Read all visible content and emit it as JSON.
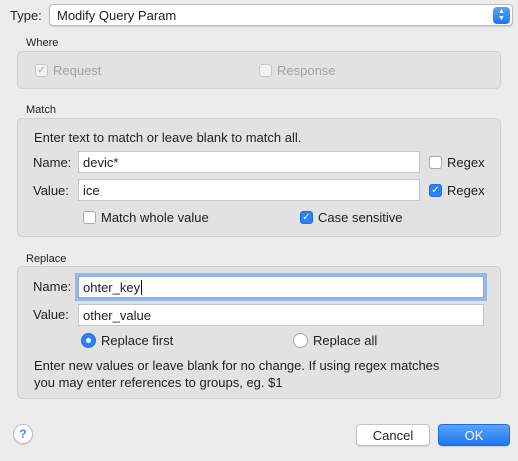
{
  "type": {
    "label": "Type:",
    "value": "Modify Query Param"
  },
  "where": {
    "title": "Where",
    "request": {
      "label": "Request",
      "checked": true,
      "enabled": false
    },
    "response": {
      "label": "Response",
      "checked": false,
      "enabled": false
    }
  },
  "match": {
    "title": "Match",
    "hint": "Enter text to match or leave blank to match all.",
    "name_label": "Name:",
    "name_value": "devic*",
    "name_regex_label": "Regex",
    "name_regex_checked": false,
    "value_label": "Value:",
    "value_value": "ice",
    "value_regex_label": "Regex",
    "value_regex_checked": true,
    "whole_value_label": "Match whole value",
    "whole_value_checked": false,
    "case_sensitive_label": "Case sensitive",
    "case_sensitive_checked": true
  },
  "replace": {
    "title": "Replace",
    "name_label": "Name:",
    "name_value": "ohter_key",
    "value_label": "Value:",
    "value_value": "other_value",
    "replace_first_label": "Replace first",
    "replace_all_label": "Replace all",
    "selected": "first",
    "hint_line1": "Enter new values or leave blank for no change. If using regex matches",
    "hint_line2": "you may enter references to groups, eg. $1"
  },
  "footer": {
    "help": "?",
    "cancel_label": "Cancel",
    "ok_label": "OK"
  },
  "colors": {
    "accent": "#2a82f4",
    "background": "#ececec",
    "group": "#e2e2e2"
  }
}
